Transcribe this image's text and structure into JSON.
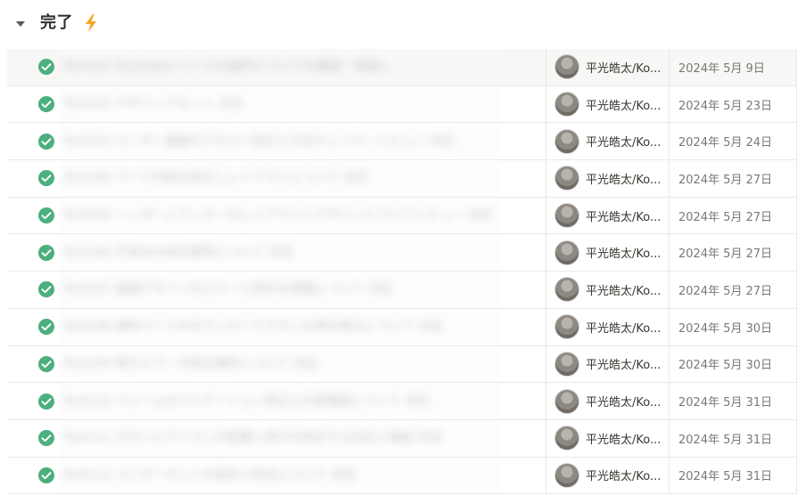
{
  "group": {
    "title": "完了",
    "toggle_icon": "caret-down-icon",
    "emoji_icon": "lightning-bolt-icon",
    "colors": {
      "bolt": "#f5a623",
      "check": "#4caf7d"
    }
  },
  "rows": [
    {
      "title": "PJ-0101 Illustrator ツールの操作についての確認・見直し",
      "assignee": "平光皓太/Ko...",
      "date": "2024年 5月 9日"
    },
    {
      "title": "PJ-0102 デザインアセット 対応",
      "assignee": "平光皓太/Ko...",
      "date": "2024年 5月 23日"
    },
    {
      "title": "PJ-0103 ユーザー画面のテキスト修正と文言チェック・レビュー 対応",
      "assignee": "平光皓太/Ko...",
      "date": "2024年 5月 24日"
    },
    {
      "title": "PJ-0104 ページ内容を修正しレイアウトについて 対応",
      "assignee": "平光皓太/Ko...",
      "date": "2024年 5月 27日"
    },
    {
      "title": "PJ-0105 ヘッダーとフッターのレイアウトとデザインについてレビュー 対応",
      "assignee": "平光皓太/Ko...",
      "date": "2024年 5月 27日"
    },
    {
      "title": "PJ-0106 不具合の修正箇所について 対応",
      "assignee": "平光皓太/Ko...",
      "date": "2024年 5月 27日"
    },
    {
      "title": "PJ-0107 画面デザインのカラーと表示を調整について 対応",
      "assignee": "平光皓太/Ko...",
      "date": "2024年 5月 27日"
    },
    {
      "title": "PJ-0108 資料ページのダウンロードボタンの表示修正について 対応",
      "assignee": "平光皓太/Ko...",
      "date": "2024年 5月 30日"
    },
    {
      "title": "PJ-0109 表示エラーの修正箇所について 対応",
      "assignee": "平光皓太/Ko...",
      "date": "2024年 5月 30日"
    },
    {
      "title": "PJ-0110 フォームのバリデーション修正と内容確認について 対応",
      "assignee": "平光皓太/Ko...",
      "date": "2024年 5月 31日"
    },
    {
      "title": "PJ-0111 ボタンとアイコンの配置と表示を修正する対応と確認 対応",
      "assignee": "平光皓太/Ko...",
      "date": "2024年 5月 31日"
    },
    {
      "title": "PJ-0112 コンポーネントの設計と修正について 対応",
      "assignee": "平光皓太/Ko...",
      "date": "2024年 5月 31日"
    }
  ]
}
